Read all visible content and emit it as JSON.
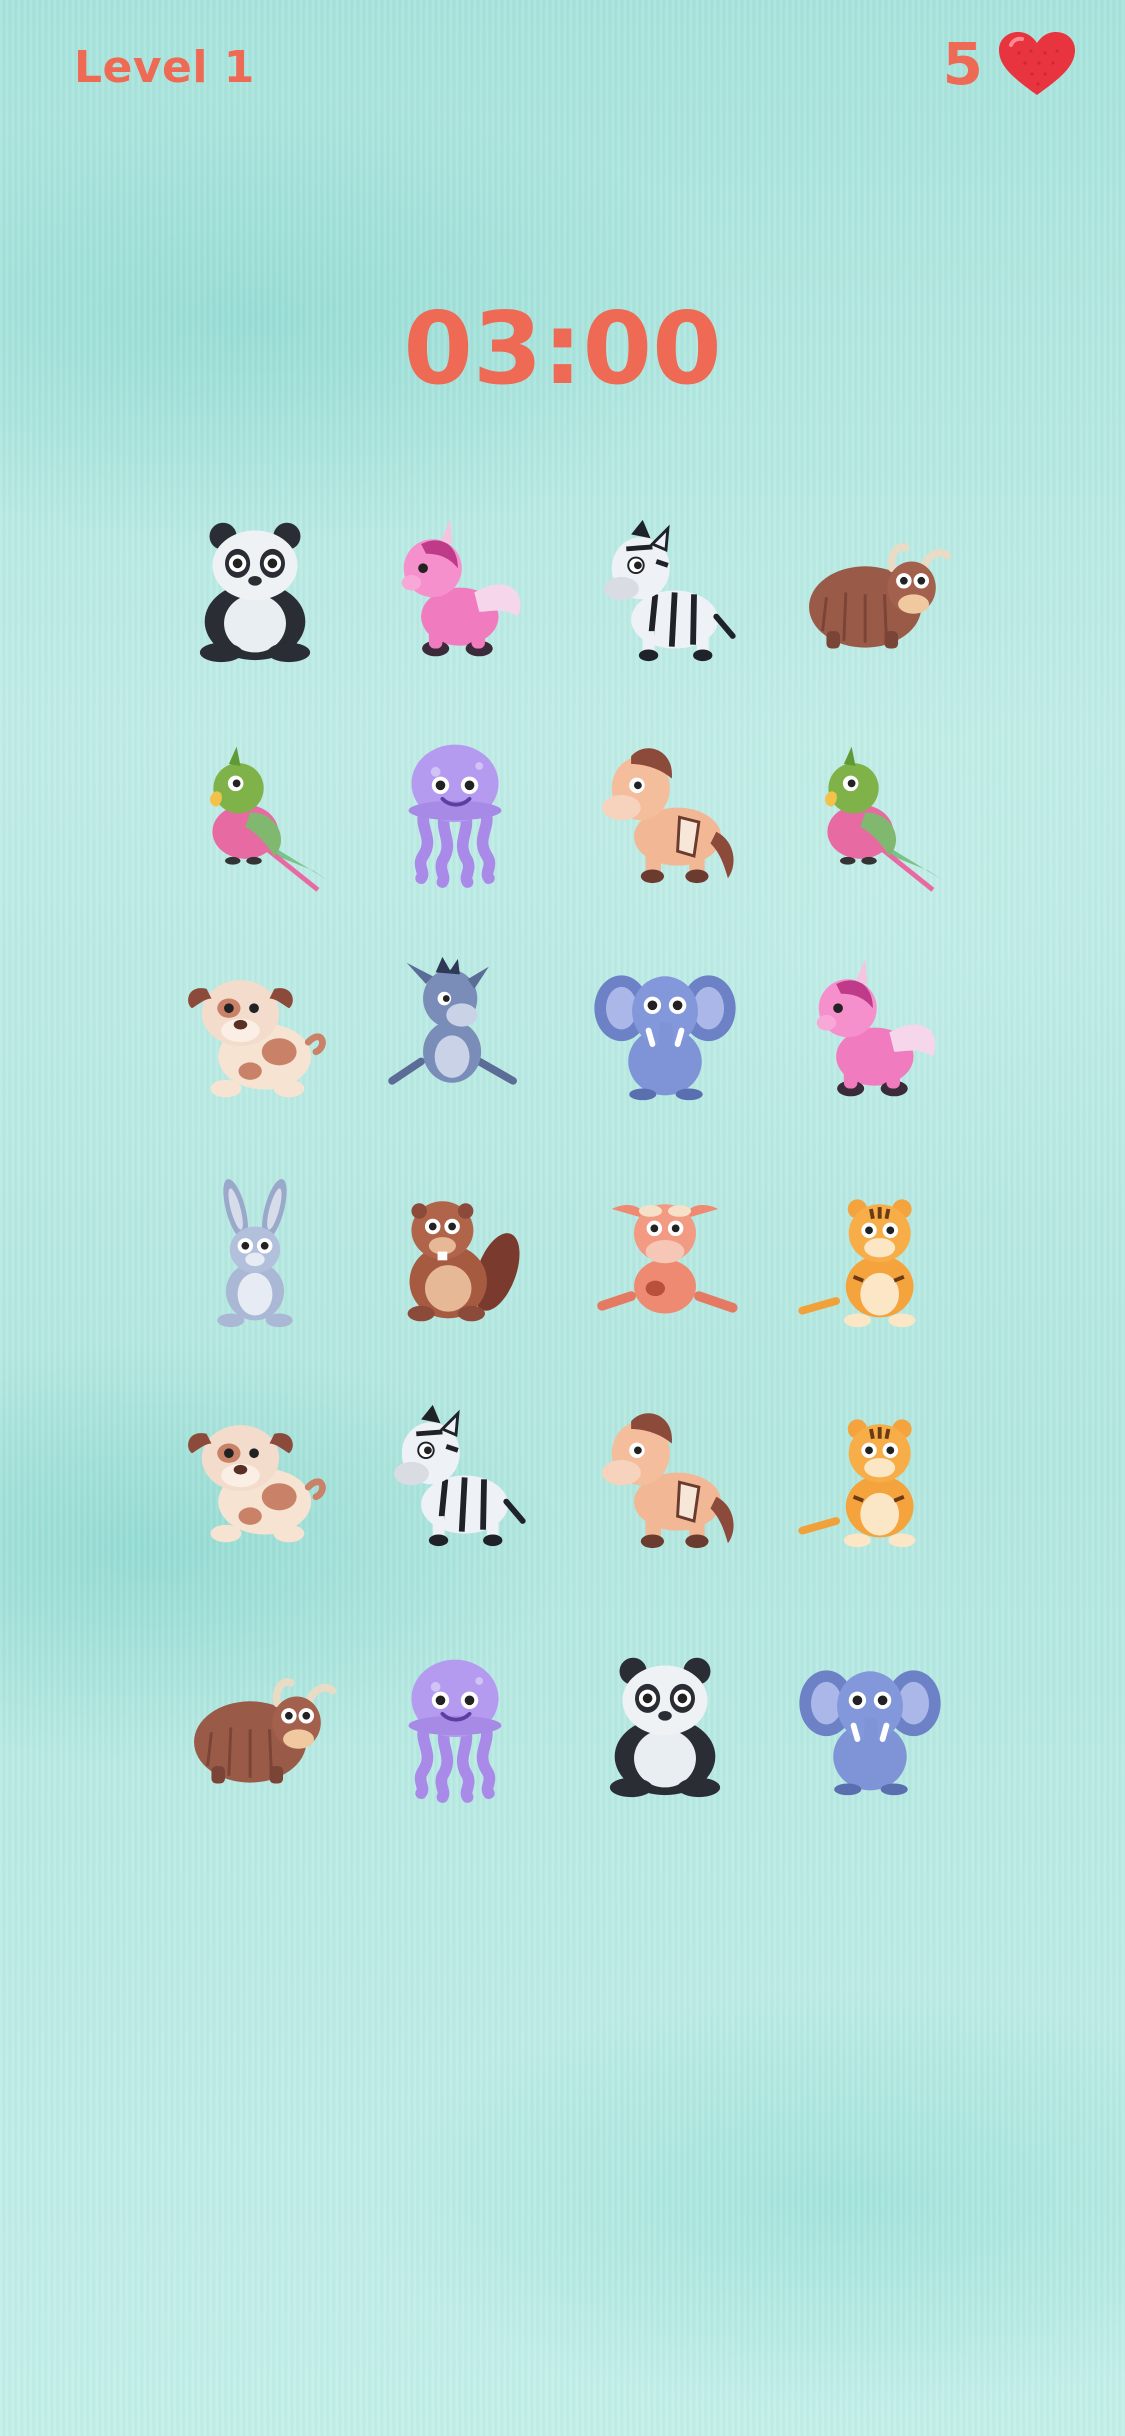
{
  "hud": {
    "level_label": "Level 1",
    "lives": "5",
    "timer": "03:00"
  },
  "colors": {
    "accent": "#ef6a55",
    "heart": "#e8343f"
  },
  "grid": {
    "rows": [
      [
        "panda",
        "unicorn",
        "zebra",
        "yak"
      ],
      [
        "parrot",
        "jellyfish",
        "horse",
        "parrot"
      ],
      [
        "dog",
        "donkey",
        "elephant",
        "unicorn"
      ],
      [
        "rabbit",
        "beaver",
        "cow",
        "tiger"
      ],
      [
        "dog",
        "zebra",
        "horse",
        "tiger"
      ],
      [
        "yak",
        "jellyfish",
        "panda",
        "elephant"
      ]
    ]
  }
}
